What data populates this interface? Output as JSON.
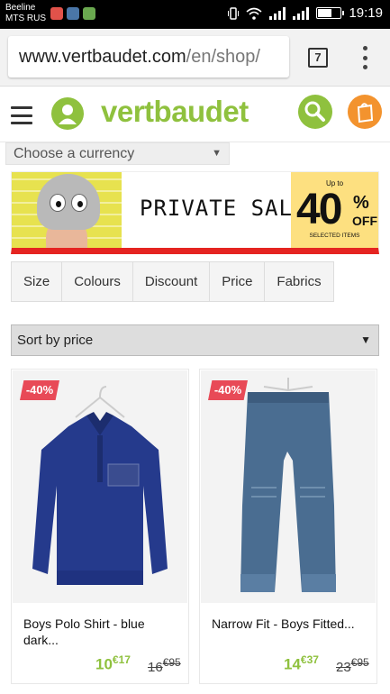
{
  "statusbar": {
    "carrier1": "Beeline",
    "carrier2": "MTS RUS",
    "time": "19:19"
  },
  "browser": {
    "url_host": "www.vertbaudet.com",
    "url_path": "/en/shop/",
    "tab_count": "7"
  },
  "header": {
    "logo": "vertbaudet",
    "accent_color": "#8fc13e",
    "bag_color": "#f3932e"
  },
  "currency": {
    "label": "Choose a currency",
    "arrow": "▼"
  },
  "banner": {
    "text": "PRIVATE SALES",
    "promo_upto": "Up to",
    "promo_value": "40",
    "promo_pct": "%",
    "promo_off": "OFF",
    "promo_selected": "SELECTED ITEMS"
  },
  "filters": [
    "Size",
    "Colours",
    "Discount",
    "Price",
    "Fabrics"
  ],
  "sort": {
    "label": "Sort by price",
    "arrow": "▼"
  },
  "products": [
    {
      "badge": "-40%",
      "name": "Boys Polo Shirt - blue dark...",
      "price_new_main": "10",
      "price_new_cents": "€17",
      "price_old_main": "16",
      "price_old_cents": "€95"
    },
    {
      "badge": "-40%",
      "name": "Narrow Fit - Boys Fitted...",
      "price_new_main": "14",
      "price_new_cents": "€37",
      "price_old_main": "23",
      "price_old_cents": "€95"
    }
  ]
}
